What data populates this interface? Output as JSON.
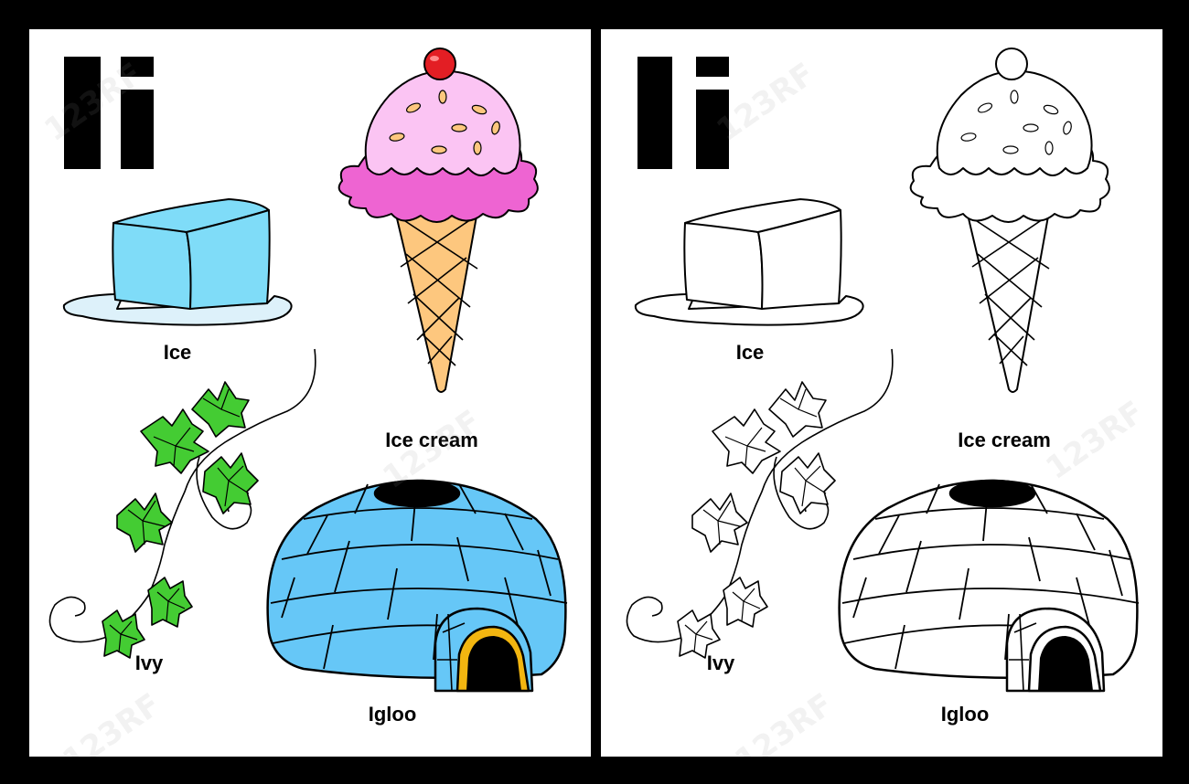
{
  "worksheet": {
    "letter_upper": "I",
    "letter_lower": "i",
    "colored_panel": {
      "labels": {
        "ice": "Ice",
        "ice_cream": "Ice cream",
        "ivy": "Ivy",
        "igloo": "Igloo"
      }
    },
    "outline_panel": {
      "labels": {
        "ice": "Ice",
        "ice_cream": "Ice cream",
        "ivy": "Ivy",
        "igloo": "Igloo"
      }
    }
  },
  "watermark": "123RF",
  "colors": {
    "ice": "#7fdcf8",
    "ice_puddle": "#ddf1fa",
    "ice_cream_scoop": "#fbc4f3",
    "ice_cream_rim": "#ee64d2",
    "cherry": "#e31e24",
    "cone": "#fdc77e",
    "ivy_leaf": "#44cc33",
    "igloo": "#66c7f7",
    "igloo_door_rim": "#f3b610"
  }
}
